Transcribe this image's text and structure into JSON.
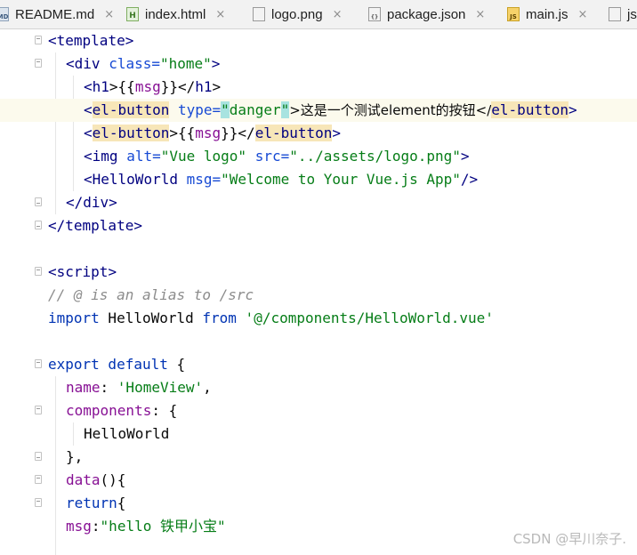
{
  "tabs": [
    {
      "label": "README.md",
      "icon": "markdown-file-icon",
      "icon_text": "MD",
      "closable": true
    },
    {
      "label": "index.html",
      "icon": "html-file-icon",
      "icon_text": "H",
      "closable": true
    },
    {
      "label": "logo.png",
      "icon": "image-file-icon",
      "icon_text": "",
      "closable": true
    },
    {
      "label": "package.json",
      "icon": "json-file-icon",
      "icon_text": "{}",
      "closable": true
    },
    {
      "label": "main.js",
      "icon": "js-file-icon",
      "icon_text": "JS",
      "closable": true
    },
    {
      "label": "js",
      "icon": "js-file-icon",
      "icon_text": "",
      "closable": false
    }
  ],
  "tab_close_glyph": "×",
  "code": {
    "l1": {
      "open": "<",
      "tag": "template",
      "close": ">"
    },
    "l2": {
      "open": "<",
      "tag": "div",
      "attr": "class",
      "eq": "=",
      "val": "\"home\"",
      "close": ">"
    },
    "l3": {
      "open": "<",
      "tag": "h1",
      "mid": ">{{",
      "expr": "msg",
      "mid2": "}}</",
      "tag2": "h1",
      "close": ">"
    },
    "l4": {
      "open": "<",
      "tag": "el-button",
      "attr": "type",
      "eq": "=",
      "q1": "\"",
      "val": "danger",
      "q2": "\"",
      "text": ">这是一个测试element的按钮</",
      "tag2": "el-button",
      "close": ">"
    },
    "l5": {
      "open": "<",
      "tag": "el-button",
      "mid": ">{{",
      "expr": "msg",
      "mid2": "}}</",
      "tag2": "el-button",
      "close": ">"
    },
    "l6": {
      "open": "<",
      "tag": "img",
      "attr": "alt",
      "eq": "=",
      "val": "\"Vue logo\"",
      "attr2": "src",
      "eq2": "=",
      "val2": "\"../assets/logo.png\"",
      "close": ">"
    },
    "l7": {
      "open": "<",
      "tag": "HelloWorld",
      "attr": "msg",
      "eq": "=",
      "val": "\"Welcome to Your Vue.js App\"",
      "close": "/>"
    },
    "l8": {
      "open": "</",
      "tag": "div",
      "close": ">"
    },
    "l9": {
      "open": "</",
      "tag": "template",
      "close": ">"
    },
    "l11": {
      "open": "<",
      "tag": "script",
      "close": ">"
    },
    "l12": {
      "comment": "// @ is an alias to /src"
    },
    "l13": {
      "kw": "import",
      "name": " HelloWorld ",
      "kw2": "from",
      "str": " '@/components/HelloWorld.vue'"
    },
    "l15": {
      "kw": "export default",
      "rest": " {"
    },
    "l16": {
      "prop": "name",
      "colon": ": ",
      "str": "'HomeView'",
      "rest": ","
    },
    "l17": {
      "prop": "components",
      "rest": ": {"
    },
    "l18": {
      "text": "HelloWorld"
    },
    "l19": {
      "text": "},"
    },
    "l20": {
      "prop": "data",
      "rest": "(){"
    },
    "l21": {
      "kw": "return",
      "rest": "{"
    },
    "l22": {
      "prop": "msg",
      "colon": ":",
      "str": "\"hello 铁甲小宝\""
    }
  },
  "watermark": "CSDN @早川奈子."
}
